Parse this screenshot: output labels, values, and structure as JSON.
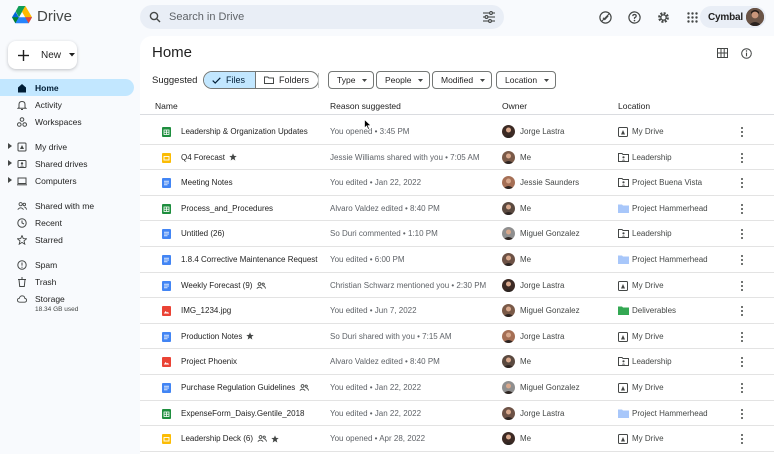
{
  "header": {
    "app_name": "Drive",
    "search_placeholder": "Search in Drive",
    "brand_label": "Cymbal"
  },
  "sidebar": {
    "new_label": "New",
    "items": [
      {
        "label": "Home",
        "icon": "home-icon",
        "active": true
      },
      {
        "label": "Activity",
        "icon": "bell-icon"
      },
      {
        "label": "Workspaces",
        "icon": "workspaces-icon"
      },
      {
        "label": "My drive",
        "icon": "my-drive-icon",
        "expandable": true
      },
      {
        "label": "Shared drives",
        "icon": "shared-drives-icon",
        "expandable": true
      },
      {
        "label": "Computers",
        "icon": "computer-icon",
        "expandable": true
      },
      {
        "label": "Shared with me",
        "icon": "people-icon"
      },
      {
        "label": "Recent",
        "icon": "clock-icon"
      },
      {
        "label": "Starred",
        "icon": "star-icon"
      },
      {
        "label": "Spam",
        "icon": "spam-icon"
      },
      {
        "label": "Trash",
        "icon": "trash-icon"
      },
      {
        "label": "Storage",
        "icon": "cloud-icon"
      }
    ],
    "storage_used": "18.34 GB used"
  },
  "main": {
    "title": "Home",
    "suggested_label": "Suggested",
    "toggle": {
      "files": "Files",
      "folders": "Folders",
      "selected": "Files"
    },
    "filters": [
      "Type",
      "People",
      "Modified",
      "Location"
    ],
    "columns": {
      "name": "Name",
      "reason": "Reason suggested",
      "owner": "Owner",
      "location": "Location"
    },
    "files": [
      {
        "type": "sheets",
        "name": "Leadership & Organization Updates",
        "reason": "You opened • 3:45 PM",
        "owner": "Jorge Lastra",
        "location": "My Drive",
        "loc_icon": "my-drive"
      },
      {
        "type": "slides",
        "name": "Q4 Forecast",
        "starred": true,
        "reason": "Jessie Williams shared with you • 7:05 AM",
        "owner": "Me",
        "location": "Leadership",
        "loc_icon": "shared-drive"
      },
      {
        "type": "docs",
        "name": "Meeting Notes",
        "reason": "You edited • Jan 22, 2022",
        "owner": "Jessie Saunders",
        "location": "Project Buena Vista",
        "loc_icon": "shared-drive"
      },
      {
        "type": "sheets",
        "name": "Process_and_Procedures",
        "reason": "Alvaro Valdez edited • 8:40 PM",
        "owner": "Me",
        "location": "Project Hammerhead",
        "loc_icon": "folder-blue"
      },
      {
        "type": "docs",
        "name": "Untitled (26)",
        "reason": "So Duri commented • 1:10 PM",
        "owner": "Miguel Gonzalez",
        "location": "Leadership",
        "loc_icon": "shared-drive"
      },
      {
        "type": "docs",
        "name": "1.8.4 Corrective Maintenance Request",
        "reason": "You edited • 6:00 PM",
        "owner": "Me",
        "location": "Project Hammerhead",
        "loc_icon": "folder-blue"
      },
      {
        "type": "docs",
        "name": "Weekly Forecast (9)",
        "shared": true,
        "reason": "Christian Schwarz mentioned you • 2:30 PM",
        "owner": "Jorge Lastra",
        "location": "My Drive",
        "loc_icon": "my-drive"
      },
      {
        "type": "image",
        "name": "IMG_1234.jpg",
        "reason": "You edited • Jun 7, 2022",
        "owner": "Miguel Gonzalez",
        "location": "Deliverables",
        "loc_icon": "folder-green"
      },
      {
        "type": "docs",
        "name": "Production Notes",
        "starred": true,
        "reason": "So Duri shared with you • 7:15 AM",
        "owner": "Jorge Lastra",
        "location": "My Drive",
        "loc_icon": "my-drive"
      },
      {
        "type": "image-red",
        "name": "Project Phoenix",
        "reason": "Alvaro Valdez edited • 8:40 PM",
        "owner": "Me",
        "location": "Leadership",
        "loc_icon": "shared-drive"
      },
      {
        "type": "docs",
        "name": "Purchase Regulation Guidelines",
        "shared": true,
        "reason": "You edited • Jan 22, 2022",
        "owner": "Miguel Gonzalez",
        "location": "My Drive",
        "loc_icon": "my-drive"
      },
      {
        "type": "sheets",
        "name": "ExpenseForm_Daisy.Gentile_2018",
        "reason": "You edited • Jan 22, 2022",
        "owner": "Jorge Lastra",
        "location": "Project Hammerhead",
        "loc_icon": "folder-blue"
      },
      {
        "type": "slides",
        "name": "Leadership Deck (6)",
        "shared": true,
        "starred": true,
        "reason": "You opened • Apr 28, 2022",
        "owner": "Me",
        "location": "My Drive",
        "loc_icon": "my-drive"
      }
    ]
  },
  "colors": {
    "sheets": "#1e8e3e",
    "slides": "#fbbc04",
    "docs": "#4285f4",
    "image": "#ea4335",
    "active_nav": "#c2e7ff",
    "folder_blue": "#a8c7fa",
    "folder_green": "#34a853"
  }
}
